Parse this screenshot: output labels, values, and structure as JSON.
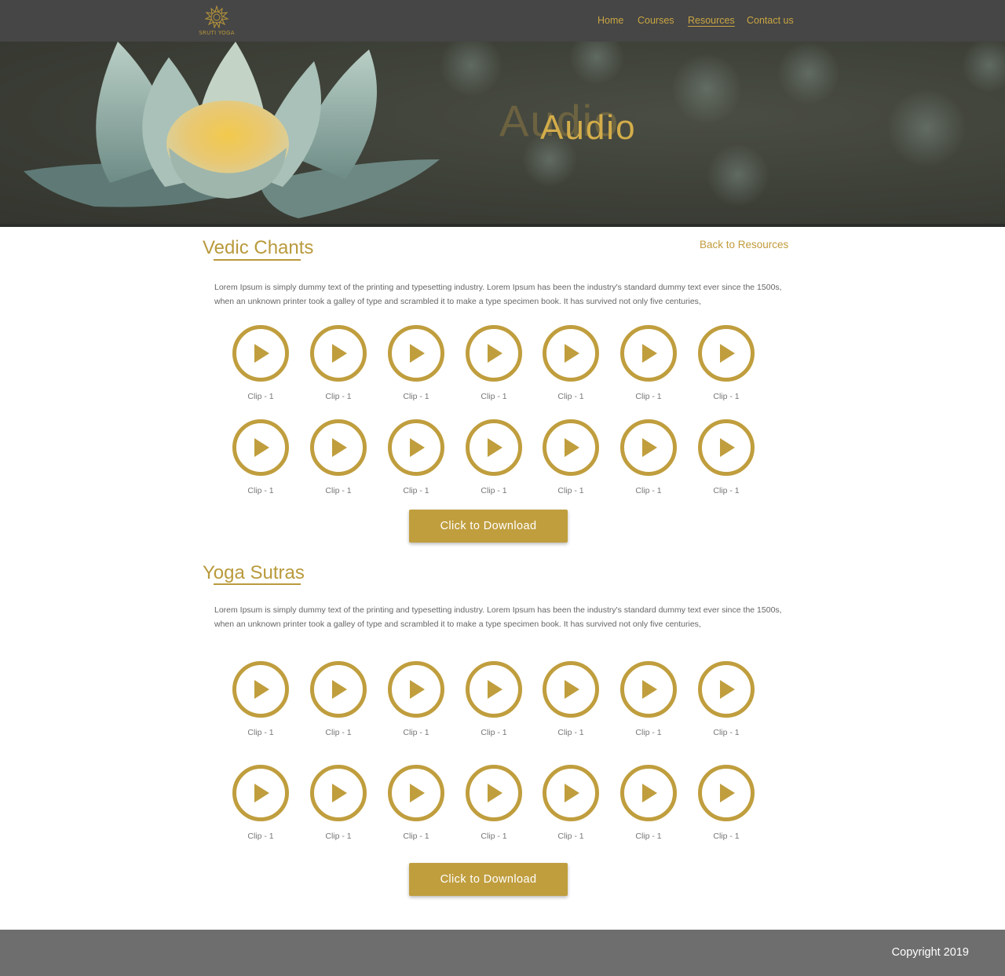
{
  "header": {
    "logo_text": "SRUTI YOGA",
    "nav": [
      {
        "label": "Home",
        "active": false
      },
      {
        "label": "Courses",
        "active": false
      },
      {
        "label": "Resources",
        "active": true
      },
      {
        "label": "Contact us",
        "active": false
      }
    ]
  },
  "hero": {
    "title": "Audio",
    "title_shadow": "Audio"
  },
  "colors": {
    "accent": "#c09e3e",
    "header_bg": "#464646",
    "footer_bg": "#6e6e6e"
  },
  "back_link": "Back to Resources",
  "sections": [
    {
      "title": "Vedic Chants",
      "description": "Lorem Ipsum is simply dummy text of the printing and typesetting industry. Lorem Ipsum has been the industry's standard dummy text ever since the 1500s, when an unknown printer took a galley of type and scrambled it to make a type specimen book. It has survived not only five centuries,",
      "clips": [
        "Clip - 1",
        "Clip - 1",
        "Clip - 1",
        "Clip - 1",
        "Clip - 1",
        "Clip - 1",
        "Clip - 1",
        "Clip - 1",
        "Clip - 1",
        "Clip - 1",
        "Clip - 1",
        "Clip - 1",
        "Clip - 1",
        "Clip - 1"
      ],
      "download_label": "Click to Download"
    },
    {
      "title": "Yoga Sutras",
      "description": "Lorem Ipsum is simply dummy text of the printing and typesetting industry. Lorem Ipsum has been the industry's standard dummy text ever since the 1500s, when an unknown printer took a galley of type and scrambled it to make a type specimen book. It has survived not only five centuries,",
      "clips": [
        "Clip - 1",
        "Clip - 1",
        "Clip - 1",
        "Clip - 1",
        "Clip - 1",
        "Clip - 1",
        "Clip - 1",
        "Clip - 1",
        "Clip - 1",
        "Clip - 1",
        "Clip - 1",
        "Clip - 1",
        "Clip - 1",
        "Clip - 1"
      ],
      "download_label": "Click to Download"
    }
  ],
  "footer": {
    "copyright": "Copyright 2019"
  }
}
